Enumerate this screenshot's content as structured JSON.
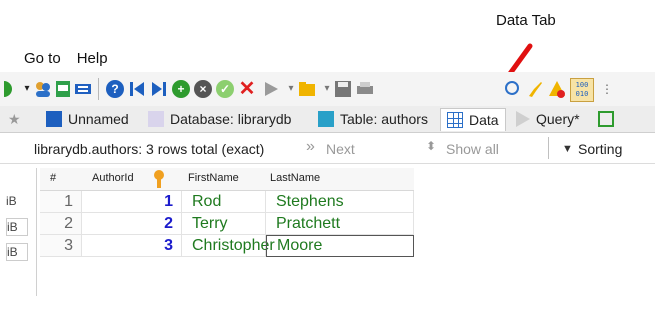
{
  "annotation": {
    "label": "Data Tab"
  },
  "menu": {
    "items": [
      "Go to",
      "Help"
    ]
  },
  "tabs": [
    {
      "label": "Unnamed"
    },
    {
      "label": "Database: librarydb"
    },
    {
      "label": "Table: authors"
    },
    {
      "label": "Data"
    },
    {
      "label": "Query*"
    }
  ],
  "filter_bar": {
    "summary": "librarydb.authors: 3 rows total (exact)",
    "next_label": "Next",
    "show_all_label": "Show all",
    "sorting_label": "Sorting"
  },
  "grid": {
    "columns": [
      "#",
      "AuthorId",
      "FirstName",
      "LastName"
    ],
    "rows": [
      {
        "num": "1",
        "id": "1",
        "first": "Rod",
        "last": "Stephens"
      },
      {
        "num": "2",
        "id": "2",
        "first": "Terry",
        "last": "Pratchett"
      },
      {
        "num": "3",
        "id": "3",
        "first": "Christopher",
        "last": "Moore"
      }
    ]
  },
  "left_panel": {
    "items": [
      "iB",
      "iB",
      "iB"
    ]
  },
  "toolbar": {
    "counter_icon_text": "100\n010"
  }
}
